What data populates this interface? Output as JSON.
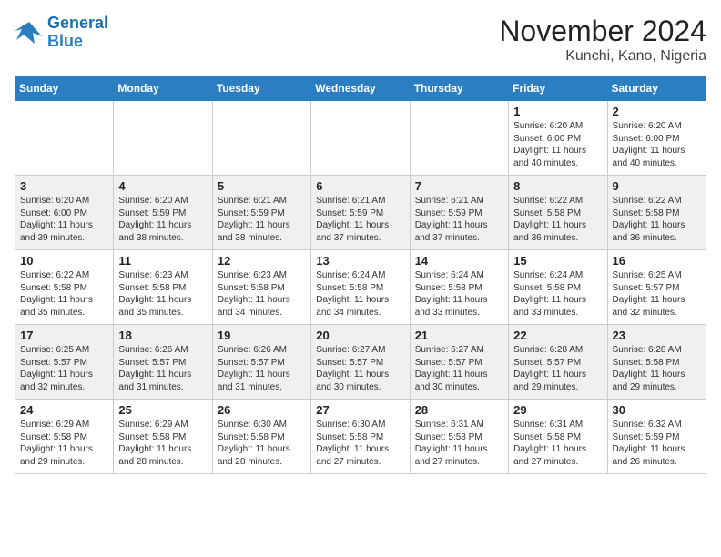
{
  "header": {
    "logo_line1": "General",
    "logo_line2": "Blue",
    "month": "November 2024",
    "location": "Kunchi, Kano, Nigeria"
  },
  "days_of_week": [
    "Sunday",
    "Monday",
    "Tuesday",
    "Wednesday",
    "Thursday",
    "Friday",
    "Saturday"
  ],
  "weeks": [
    [
      {
        "day": "",
        "info": ""
      },
      {
        "day": "",
        "info": ""
      },
      {
        "day": "",
        "info": ""
      },
      {
        "day": "",
        "info": ""
      },
      {
        "day": "",
        "info": ""
      },
      {
        "day": "1",
        "info": "Sunrise: 6:20 AM\nSunset: 6:00 PM\nDaylight: 11 hours and 40 minutes."
      },
      {
        "day": "2",
        "info": "Sunrise: 6:20 AM\nSunset: 6:00 PM\nDaylight: 11 hours and 40 minutes."
      }
    ],
    [
      {
        "day": "3",
        "info": "Sunrise: 6:20 AM\nSunset: 6:00 PM\nDaylight: 11 hours and 39 minutes."
      },
      {
        "day": "4",
        "info": "Sunrise: 6:20 AM\nSunset: 5:59 PM\nDaylight: 11 hours and 38 minutes."
      },
      {
        "day": "5",
        "info": "Sunrise: 6:21 AM\nSunset: 5:59 PM\nDaylight: 11 hours and 38 minutes."
      },
      {
        "day": "6",
        "info": "Sunrise: 6:21 AM\nSunset: 5:59 PM\nDaylight: 11 hours and 37 minutes."
      },
      {
        "day": "7",
        "info": "Sunrise: 6:21 AM\nSunset: 5:59 PM\nDaylight: 11 hours and 37 minutes."
      },
      {
        "day": "8",
        "info": "Sunrise: 6:22 AM\nSunset: 5:58 PM\nDaylight: 11 hours and 36 minutes."
      },
      {
        "day": "9",
        "info": "Sunrise: 6:22 AM\nSunset: 5:58 PM\nDaylight: 11 hours and 36 minutes."
      }
    ],
    [
      {
        "day": "10",
        "info": "Sunrise: 6:22 AM\nSunset: 5:58 PM\nDaylight: 11 hours and 35 minutes."
      },
      {
        "day": "11",
        "info": "Sunrise: 6:23 AM\nSunset: 5:58 PM\nDaylight: 11 hours and 35 minutes."
      },
      {
        "day": "12",
        "info": "Sunrise: 6:23 AM\nSunset: 5:58 PM\nDaylight: 11 hours and 34 minutes."
      },
      {
        "day": "13",
        "info": "Sunrise: 6:24 AM\nSunset: 5:58 PM\nDaylight: 11 hours and 34 minutes."
      },
      {
        "day": "14",
        "info": "Sunrise: 6:24 AM\nSunset: 5:58 PM\nDaylight: 11 hours and 33 minutes."
      },
      {
        "day": "15",
        "info": "Sunrise: 6:24 AM\nSunset: 5:58 PM\nDaylight: 11 hours and 33 minutes."
      },
      {
        "day": "16",
        "info": "Sunrise: 6:25 AM\nSunset: 5:57 PM\nDaylight: 11 hours and 32 minutes."
      }
    ],
    [
      {
        "day": "17",
        "info": "Sunrise: 6:25 AM\nSunset: 5:57 PM\nDaylight: 11 hours and 32 minutes."
      },
      {
        "day": "18",
        "info": "Sunrise: 6:26 AM\nSunset: 5:57 PM\nDaylight: 11 hours and 31 minutes."
      },
      {
        "day": "19",
        "info": "Sunrise: 6:26 AM\nSunset: 5:57 PM\nDaylight: 11 hours and 31 minutes."
      },
      {
        "day": "20",
        "info": "Sunrise: 6:27 AM\nSunset: 5:57 PM\nDaylight: 11 hours and 30 minutes."
      },
      {
        "day": "21",
        "info": "Sunrise: 6:27 AM\nSunset: 5:57 PM\nDaylight: 11 hours and 30 minutes."
      },
      {
        "day": "22",
        "info": "Sunrise: 6:28 AM\nSunset: 5:57 PM\nDaylight: 11 hours and 29 minutes."
      },
      {
        "day": "23",
        "info": "Sunrise: 6:28 AM\nSunset: 5:58 PM\nDaylight: 11 hours and 29 minutes."
      }
    ],
    [
      {
        "day": "24",
        "info": "Sunrise: 6:29 AM\nSunset: 5:58 PM\nDaylight: 11 hours and 29 minutes."
      },
      {
        "day": "25",
        "info": "Sunrise: 6:29 AM\nSunset: 5:58 PM\nDaylight: 11 hours and 28 minutes."
      },
      {
        "day": "26",
        "info": "Sunrise: 6:30 AM\nSunset: 5:58 PM\nDaylight: 11 hours and 28 minutes."
      },
      {
        "day": "27",
        "info": "Sunrise: 6:30 AM\nSunset: 5:58 PM\nDaylight: 11 hours and 27 minutes."
      },
      {
        "day": "28",
        "info": "Sunrise: 6:31 AM\nSunset: 5:58 PM\nDaylight: 11 hours and 27 minutes."
      },
      {
        "day": "29",
        "info": "Sunrise: 6:31 AM\nSunset: 5:58 PM\nDaylight: 11 hours and 27 minutes."
      },
      {
        "day": "30",
        "info": "Sunrise: 6:32 AM\nSunset: 5:59 PM\nDaylight: 11 hours and 26 minutes."
      }
    ]
  ]
}
